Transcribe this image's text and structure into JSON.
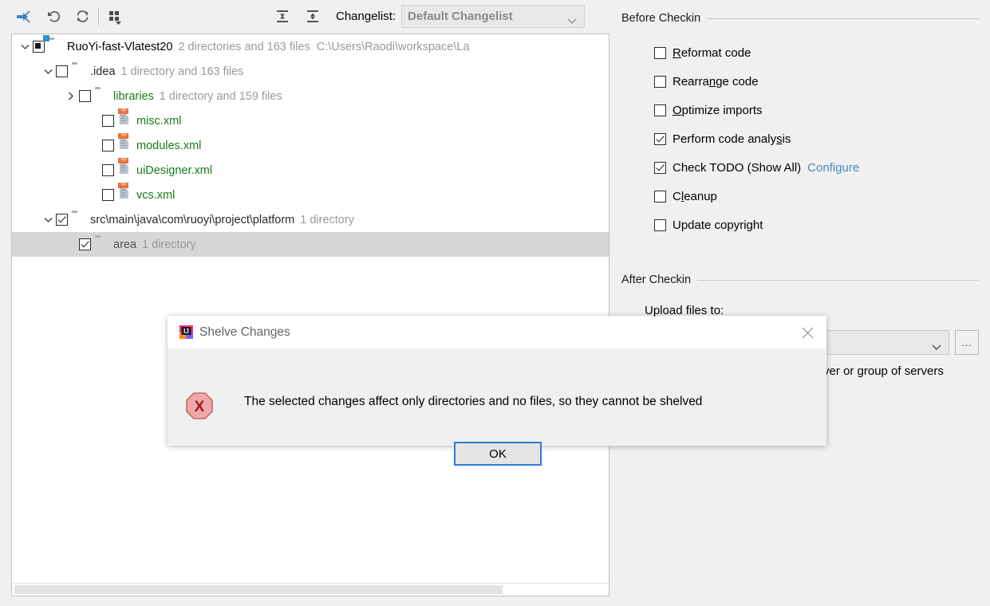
{
  "toolbar": {
    "buttons": [
      {
        "name": "shelve-silently-icon",
        "title": "Shelve Silently"
      },
      {
        "name": "rollback-icon",
        "title": "Rollback"
      },
      {
        "name": "refresh-icon",
        "title": "Refresh"
      },
      {
        "name": "group-by-icon",
        "title": "Group By"
      },
      {
        "name": "expand-all-icon",
        "title": "Expand All"
      },
      {
        "name": "collapse-all-icon",
        "title": "Collapse All"
      }
    ],
    "changelist_label": "Changelist:",
    "changelist_value": "Default Changelist"
  },
  "tree": {
    "rows": [
      {
        "indent": 0,
        "twisty": "down",
        "check": "partial",
        "icon": "module-folder-icon",
        "name": "RuoYi-fast-Vlatest20",
        "name_style": "dir-root",
        "info": "2 directories and 163 files",
        "path": "C:\\Users\\Raodi\\workspace\\La",
        "selected": false
      },
      {
        "indent": 1,
        "twisty": "down",
        "check": "unchecked",
        "icon": "folder-icon",
        "name": ".idea",
        "name_style": "dir",
        "info": "1 directory and 163 files",
        "path": "",
        "selected": false
      },
      {
        "indent": 2,
        "twisty": "right",
        "check": "unchecked",
        "icon": "folder-icon",
        "name": "libraries",
        "name_style": "green",
        "info": "1 directory and 159 files",
        "path": "",
        "selected": false
      },
      {
        "indent": 3,
        "twisty": "none",
        "check": "unchecked",
        "icon": "xml-file-icon",
        "name": "misc.xml",
        "name_style": "green",
        "info": "",
        "path": "",
        "selected": false
      },
      {
        "indent": 3,
        "twisty": "none",
        "check": "unchecked",
        "icon": "xml-file-icon",
        "name": "modules.xml",
        "name_style": "green",
        "info": "",
        "path": "",
        "selected": false
      },
      {
        "indent": 3,
        "twisty": "none",
        "check": "unchecked",
        "icon": "xml-file-icon",
        "name": "uiDesigner.xml",
        "name_style": "green",
        "info": "",
        "path": "",
        "selected": false
      },
      {
        "indent": 3,
        "twisty": "none",
        "check": "unchecked",
        "icon": "xml-file-icon",
        "name": "vcs.xml",
        "name_style": "green",
        "info": "",
        "path": "",
        "selected": false
      },
      {
        "indent": 1,
        "twisty": "down",
        "check": "checked",
        "icon": "folder-icon",
        "name": "src\\main\\java\\com\\ruoyi\\project\\platform",
        "name_style": "dir",
        "info": "1 directory",
        "path": "",
        "selected": false
      },
      {
        "indent": 2,
        "twisty": "none",
        "check": "checked",
        "icon": "folder-icon",
        "name": "area",
        "name_style": "gray",
        "info": "1 directory",
        "path": "",
        "selected": true
      }
    ]
  },
  "before_checkin": {
    "title": "Before Checkin",
    "options": [
      {
        "label_pre": "",
        "mnemonic": "R",
        "label_post": "eformat code",
        "checked": false,
        "name": "reformat-code"
      },
      {
        "label_pre": "Rearra",
        "mnemonic": "n",
        "label_post": "ge code",
        "checked": false,
        "name": "rearrange-code"
      },
      {
        "label_pre": "",
        "mnemonic": "O",
        "label_post": "ptimize imports",
        "checked": false,
        "name": "optimize-imports"
      },
      {
        "label_pre": "Perform code analy",
        "mnemonic": "s",
        "label_post": "is",
        "checked": true,
        "name": "perform-code-analysis"
      },
      {
        "label_pre": "Check TODO (Show All)",
        "mnemonic": "",
        "label_post": "",
        "checked": true,
        "name": "check-todo",
        "link": "Configure"
      },
      {
        "label_pre": "C",
        "mnemonic": "l",
        "label_post": "eanup",
        "checked": false,
        "name": "cleanup"
      },
      {
        "label_pre": "Update copyright",
        "mnemonic": "",
        "label_post": "",
        "checked": false,
        "name": "update-copyright"
      }
    ]
  },
  "after_checkin": {
    "title": "After Checkin",
    "upload_label": "Upload files to:",
    "upload_value": "",
    "browse_label": "...",
    "hint": "ver or group of servers"
  },
  "dialog": {
    "title": "Shelve Changes",
    "message": "The selected changes affect only directories and no files, so they cannot be shelved",
    "ok_label": "OK",
    "icon": "intellij-idea-logo-icon",
    "error_icon": "error-octagon-icon",
    "close_icon": "close-icon"
  },
  "colors": {
    "accent_blue": "#2d7cd6",
    "link_blue": "#4a88c7",
    "file_green": "#1a7a1a",
    "error_red": "#9c1b1b",
    "panel_bg": "#f0f0f0"
  }
}
